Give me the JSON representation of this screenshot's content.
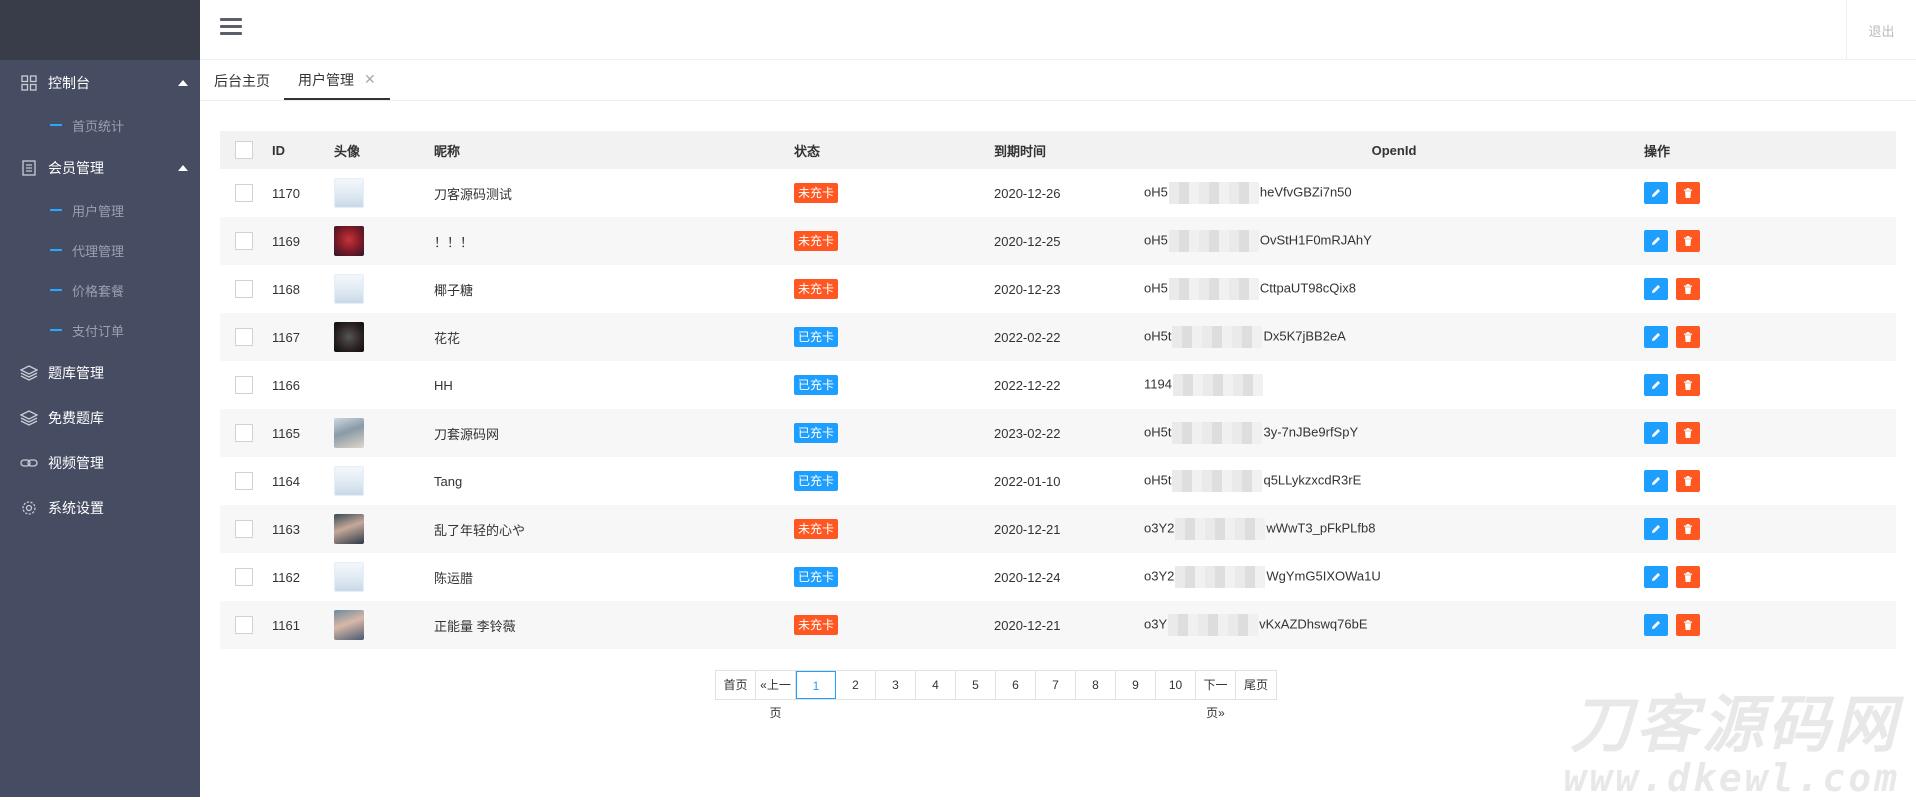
{
  "sidebar": {
    "menus": [
      {
        "label": "控制台",
        "icon": "dashboard-icon",
        "expanded": true,
        "subs": [
          "首页统计"
        ]
      },
      {
        "label": "会员管理",
        "icon": "document-icon",
        "expanded": true,
        "subs": [
          "用户管理",
          "代理管理",
          "价格套餐",
          "支付订单"
        ]
      },
      {
        "label": "题库管理",
        "icon": "layers-icon"
      },
      {
        "label": "免费题库",
        "icon": "layers-icon"
      },
      {
        "label": "视频管理",
        "icon": "link-icon"
      },
      {
        "label": "系统设置",
        "icon": "gear-icon"
      }
    ]
  },
  "header": {
    "logout": "退出",
    "menu_icon": "hamburger-icon"
  },
  "tabs": [
    {
      "label": "后台主页",
      "active": false
    },
    {
      "label": "用户管理",
      "active": true,
      "close": "✕"
    }
  ],
  "table": {
    "columns": [
      "ID",
      "头像",
      "昵称",
      "状态",
      "到期时间",
      "OpenId",
      "操作"
    ],
    "rows": [
      {
        "id": "1170",
        "avatar": "placeholder",
        "nick": "刀客源码测试",
        "status": "未充卡",
        "status_color": "#ff5722",
        "expire": "2020-12-26",
        "openid_pre": "oH5",
        "openid_post": "heVfvGBZi7n50"
      },
      {
        "id": "1169",
        "avatar": "photo1",
        "nick": "！！！",
        "status": "未充卡",
        "status_color": "#ff5722",
        "expire": "2020-12-25",
        "openid_pre": "oH5",
        "openid_post": "OvStH1F0mRJAhY"
      },
      {
        "id": "1168",
        "avatar": "placeholder",
        "nick": "椰子糖",
        "status": "未充卡",
        "status_color": "#ff5722",
        "expire": "2020-12-23",
        "openid_pre": "oH5",
        "openid_post": "CttpaUT98cQix8"
      },
      {
        "id": "1167",
        "avatar": "photo2",
        "nick": "花花",
        "status": "已充卡",
        "status_color": "#1e9fff",
        "expire": "2022-02-22",
        "openid_pre": "oH5t",
        "openid_post": "Dx5K7jBB2eA"
      },
      {
        "id": "1166",
        "avatar": "none",
        "nick": "HH",
        "status": "已充卡",
        "status_color": "#1e9fff",
        "expire": "2022-12-22",
        "openid_pre": "1194",
        "openid_post": ""
      },
      {
        "id": "1165",
        "avatar": "photo3",
        "nick": "刀套源码网",
        "status": "已充卡",
        "status_color": "#1e9fff",
        "expire": "2023-02-22",
        "openid_pre": "oH5t",
        "openid_post": "3y-7nJBe9rfSpY"
      },
      {
        "id": "1164",
        "avatar": "placeholder",
        "nick": "Tang",
        "status": "已充卡",
        "status_color": "#1e9fff",
        "expire": "2022-01-10",
        "openid_pre": "oH5t",
        "openid_post": "q5LLykzxcdR3rE"
      },
      {
        "id": "1163",
        "avatar": "photo4",
        "nick": "乱了年轻的心や",
        "status": "未充卡",
        "status_color": "#ff5722",
        "expire": "2020-12-21",
        "openid_pre": "o3Y2",
        "openid_post": "wWwT3_pFkPLfb8"
      },
      {
        "id": "1162",
        "avatar": "placeholder",
        "nick": "陈运腊",
        "status": "已充卡",
        "status_color": "#1e9fff",
        "expire": "2020-12-24",
        "openid_pre": "o3Y2",
        "openid_post": "WgYmG5IXOWa1U"
      },
      {
        "id": "1161",
        "avatar": "photo5",
        "nick": "正能量 李铃薇",
        "status": "未充卡",
        "status_color": "#ff5722",
        "expire": "2020-12-21",
        "openid_pre": "o3Y",
        "openid_post": "vKxAZDhswq76bE"
      }
    ]
  },
  "pagination": {
    "first": "首页",
    "prev": "«上一页",
    "pages": [
      "1",
      "2",
      "3",
      "4",
      "5",
      "6",
      "7",
      "8",
      "9",
      "10"
    ],
    "current": "1",
    "next": "下一页»",
    "last": "尾页"
  },
  "watermark": {
    "line1": "刀客源码网",
    "line2": "www.dkewl.com"
  },
  "colors": {
    "sidebar_bg": "#464d62",
    "logo_bg": "#393d49",
    "accent": "#1e9fff",
    "danger": "#ff5722"
  }
}
